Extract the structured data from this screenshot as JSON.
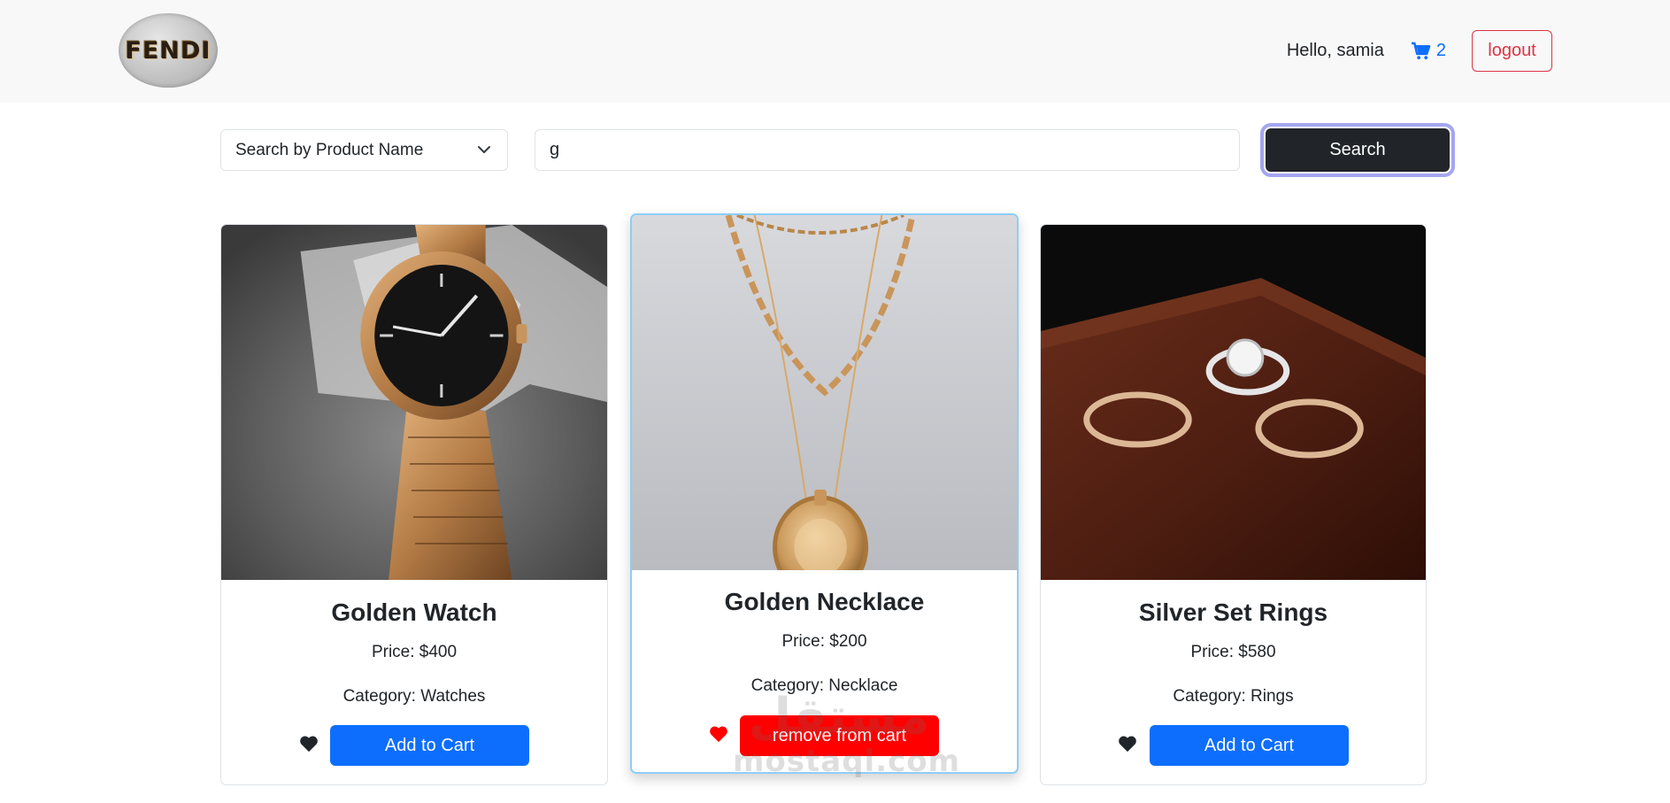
{
  "navbar": {
    "logo_text": "FENDI",
    "greeting": "Hello, samia",
    "cart_count": "2",
    "logout_label": "logout"
  },
  "search": {
    "mode_selected": "Search by Product Name",
    "query_value": "g",
    "button_label": "Search"
  },
  "products": [
    {
      "title": "Golden Watch",
      "price": "Price: $400",
      "category": "Category: Watches",
      "action_label": "Add to Cart",
      "favorite": false
    },
    {
      "title": "Golden Necklace",
      "price": "Price: $200",
      "category": "Category: Necklace",
      "action_label": "remove from cart",
      "favorite": true
    },
    {
      "title": "Silver Set Rings",
      "price": "Price: $580",
      "category": "Category: Rings",
      "action_label": "Add to Cart",
      "favorite": false
    }
  ],
  "watermark": {
    "arabic": "مستقل",
    "latin": "mostaql.com"
  },
  "colors": {
    "primary": "#0d6efd",
    "danger": "#dc3545",
    "remove": "#ff0000",
    "dark": "#212529"
  },
  "icons": [
    "cart-icon",
    "chevron-down-icon",
    "heart-icon"
  ]
}
